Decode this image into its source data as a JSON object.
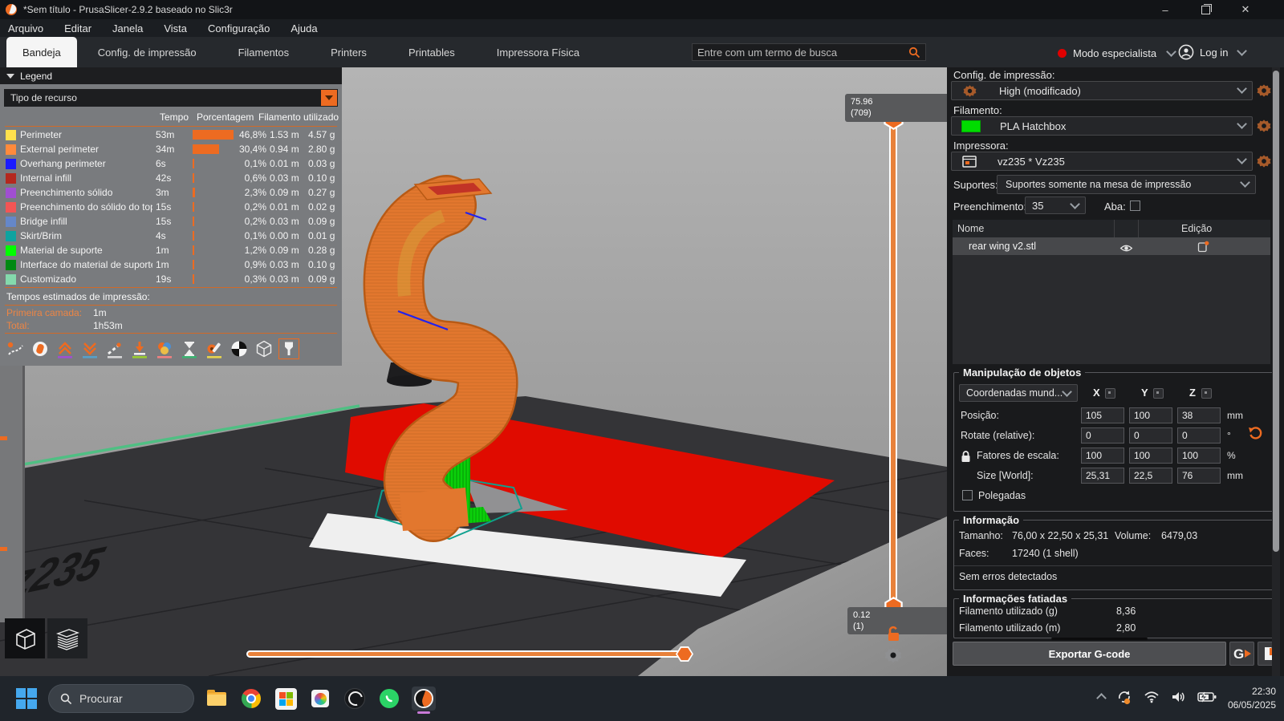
{
  "colors": {
    "accent_orange": "#ED6B21",
    "slider_orange": "#E8813A",
    "support_green": "#00DC00",
    "bed_green_stripe": "#4FBF83",
    "logo_red": "#E00B00",
    "mode_dot_red": "#E00000",
    "active_app_underline": "#C87AD8"
  },
  "window": {
    "title": "*Sem título - PrusaSlicer-2.9.2 baseado no Slic3r",
    "controls": {
      "minimize": "–",
      "restore": "restore",
      "close": "✕"
    }
  },
  "menu": [
    "Arquivo",
    "Editar",
    "Janela",
    "Vista",
    "Configuração",
    "Ajuda"
  ],
  "tabbar": {
    "tabs": [
      "Bandeja",
      "Config. de impressão",
      "Filamentos",
      "Printers",
      "Printables",
      "Impressora Física"
    ],
    "active_tab": "Bandeja",
    "search_placeholder": "Entre com um termo de busca",
    "mode_label": "Modo especialista",
    "login_label": "Log in"
  },
  "legend": {
    "title": "Legend",
    "view_type_value": "Tipo de recurso",
    "columns": {
      "time": "Tempo",
      "percent": "Porcentagem",
      "filament": "Filamento utilizado"
    },
    "rows": [
      {
        "color": "#FFE14D",
        "label": "Perimeter",
        "time": "53m",
        "pct": 46.8,
        "percent": "46,8%",
        "meters": "1.53 m",
        "grams": "4.57 g"
      },
      {
        "color": "#FF8A3C",
        "label": "External perimeter",
        "time": "34m",
        "pct": 30.4,
        "percent": "30,4%",
        "meters": "0.94 m",
        "grams": "2.80 g"
      },
      {
        "color": "#1B1BFF",
        "label": "Overhang perimeter",
        "time": "6s",
        "pct": 0.1,
        "percent": "0,1%",
        "meters": "0.01 m",
        "grams": "0.03 g"
      },
      {
        "color": "#B4281E",
        "label": "Internal infill",
        "time": "42s",
        "pct": 0.6,
        "percent": "0,6%",
        "meters": "0.03 m",
        "grams": "0.10 g"
      },
      {
        "color": "#A04FD1",
        "label": "Preenchimento sólido",
        "time": "3m",
        "pct": 2.3,
        "percent": "2,3%",
        "meters": "0.09 m",
        "grams": "0.27 g"
      },
      {
        "color": "#F25555",
        "label": "Preenchimento do sólido do topo",
        "time": "15s",
        "pct": 0.2,
        "percent": "0,2%",
        "meters": "0.01 m",
        "grams": "0.02 g"
      },
      {
        "color": "#6587C9",
        "label": "Bridge infill",
        "time": "15s",
        "pct": 0.2,
        "percent": "0,2%",
        "meters": "0.03 m",
        "grams": "0.09 g"
      },
      {
        "color": "#0FA3A0",
        "label": "Skirt/Brim",
        "time": "4s",
        "pct": 0.1,
        "percent": "0,1%",
        "meters": "0.00 m",
        "grams": "0.01 g"
      },
      {
        "color": "#00FF00",
        "label": "Material de suporte",
        "time": "1m",
        "pct": 1.2,
        "percent": "1,2%",
        "meters": "0.09 m",
        "grams": "0.28 g"
      },
      {
        "color": "#008912",
        "label": "Interface do material de suporte",
        "time": "1m",
        "pct": 0.9,
        "percent": "0,9%",
        "meters": "0.03 m",
        "grams": "0.10 g"
      },
      {
        "color": "#84D9AC",
        "label": "Customizado",
        "time": "19s",
        "pct": 0.3,
        "percent": "0,3%",
        "meters": "0.03 m",
        "grams": "0.09 g"
      }
    ],
    "estimates": {
      "title": "Tempos estimados de impressão:",
      "first_layer_label": "Primeira camada:",
      "first_layer_value": "1m",
      "total_label": "Total:",
      "total_value": "1h53m"
    },
    "toolbar_icon_names": [
      "travels-icon",
      "wipe-icon",
      "retractions-icon",
      "deretractions-icon",
      "seams-icon",
      "tool-change-icon",
      "color-changes-icon",
      "pauses-icon",
      "custom-gcode-icon",
      "center-of-mass-icon",
      "shells-icon",
      "nozzle-icon"
    ]
  },
  "viewport": {
    "bed_label": "z235",
    "vertical_slider": {
      "top_value": "75.96",
      "top_layer": "(709)",
      "bottom_value": "0.12",
      "bottom_layer": "(1)"
    },
    "horizontal_slider": {
      "value": "122641"
    }
  },
  "sidebar": {
    "print_settings_label": "Config. de impressão:",
    "print_settings_value": "High (modificado)",
    "filament_label": "Filamento:",
    "filament_value": "PLA Hatchbox",
    "filament_color": "#00DC00",
    "printer_label": "Impressora:",
    "printer_value": "vz235 * Vz235",
    "supports_label": "Suportes:",
    "supports_value": "Suportes somente na mesa de impressão",
    "infill_label": "Preenchimento:",
    "infill_value": "35",
    "brim_label": "Aba:",
    "objects": {
      "name_header": "Nome",
      "edit_header": "Edição",
      "rows": [
        {
          "name": "rear wing v2.stl"
        }
      ]
    },
    "manipulation": {
      "title": "Manipulação de objetos",
      "coords_value": "Coordenadas mund...",
      "axes": [
        "X",
        "Y",
        "Z"
      ],
      "rows": [
        {
          "label": "Posição:",
          "x": "105",
          "y": "100",
          "z": "38",
          "unit": "mm"
        },
        {
          "label": "Rotate (relative):",
          "x": "0",
          "y": "0",
          "z": "0",
          "unit": "°"
        },
        {
          "label": "Fatores de escala:",
          "x": "100",
          "y": "100",
          "z": "100",
          "unit": "%"
        },
        {
          "label": "Size [World]:",
          "x": "25,31",
          "y": "22,5",
          "z": "76",
          "unit": "mm"
        }
      ],
      "inches_label": "Polegadas"
    },
    "info": {
      "title": "Informação",
      "size_label": "Tamanho:",
      "size_value": "76,00 x 22,50 x 25,31",
      "volume_label": "Volume:",
      "volume_value": "6479,03",
      "faces_label": "Faces:",
      "faces_value": "17240 (1 shell)",
      "status": "Sem erros detectados"
    },
    "sliced": {
      "title": "Informações fatiadas",
      "rows": [
        {
          "label": "Filamento utilizado (g)",
          "value": "8,36"
        },
        {
          "label": "Filamento utilizado (m)",
          "value": "2,80"
        }
      ]
    },
    "export_button": "Exportar G-code"
  },
  "taskbar": {
    "search_placeholder": "Procurar",
    "time": "22:30",
    "date": "06/05/2025"
  }
}
